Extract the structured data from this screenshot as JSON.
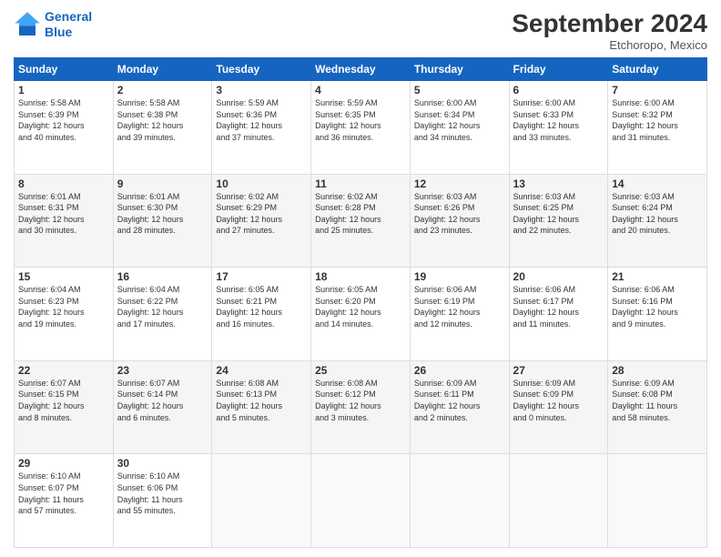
{
  "header": {
    "logo_line1": "General",
    "logo_line2": "Blue",
    "month": "September 2024",
    "location": "Etchoropo, Mexico"
  },
  "weekdays": [
    "Sunday",
    "Monday",
    "Tuesday",
    "Wednesday",
    "Thursday",
    "Friday",
    "Saturday"
  ],
  "weeks": [
    [
      {
        "day": "1",
        "info": "Sunrise: 5:58 AM\nSunset: 6:39 PM\nDaylight: 12 hours\nand 40 minutes."
      },
      {
        "day": "2",
        "info": "Sunrise: 5:58 AM\nSunset: 6:38 PM\nDaylight: 12 hours\nand 39 minutes."
      },
      {
        "day": "3",
        "info": "Sunrise: 5:59 AM\nSunset: 6:36 PM\nDaylight: 12 hours\nand 37 minutes."
      },
      {
        "day": "4",
        "info": "Sunrise: 5:59 AM\nSunset: 6:35 PM\nDaylight: 12 hours\nand 36 minutes."
      },
      {
        "day": "5",
        "info": "Sunrise: 6:00 AM\nSunset: 6:34 PM\nDaylight: 12 hours\nand 34 minutes."
      },
      {
        "day": "6",
        "info": "Sunrise: 6:00 AM\nSunset: 6:33 PM\nDaylight: 12 hours\nand 33 minutes."
      },
      {
        "day": "7",
        "info": "Sunrise: 6:00 AM\nSunset: 6:32 PM\nDaylight: 12 hours\nand 31 minutes."
      }
    ],
    [
      {
        "day": "8",
        "info": "Sunrise: 6:01 AM\nSunset: 6:31 PM\nDaylight: 12 hours\nand 30 minutes."
      },
      {
        "day": "9",
        "info": "Sunrise: 6:01 AM\nSunset: 6:30 PM\nDaylight: 12 hours\nand 28 minutes."
      },
      {
        "day": "10",
        "info": "Sunrise: 6:02 AM\nSunset: 6:29 PM\nDaylight: 12 hours\nand 27 minutes."
      },
      {
        "day": "11",
        "info": "Sunrise: 6:02 AM\nSunset: 6:28 PM\nDaylight: 12 hours\nand 25 minutes."
      },
      {
        "day": "12",
        "info": "Sunrise: 6:03 AM\nSunset: 6:26 PM\nDaylight: 12 hours\nand 23 minutes."
      },
      {
        "day": "13",
        "info": "Sunrise: 6:03 AM\nSunset: 6:25 PM\nDaylight: 12 hours\nand 22 minutes."
      },
      {
        "day": "14",
        "info": "Sunrise: 6:03 AM\nSunset: 6:24 PM\nDaylight: 12 hours\nand 20 minutes."
      }
    ],
    [
      {
        "day": "15",
        "info": "Sunrise: 6:04 AM\nSunset: 6:23 PM\nDaylight: 12 hours\nand 19 minutes."
      },
      {
        "day": "16",
        "info": "Sunrise: 6:04 AM\nSunset: 6:22 PM\nDaylight: 12 hours\nand 17 minutes."
      },
      {
        "day": "17",
        "info": "Sunrise: 6:05 AM\nSunset: 6:21 PM\nDaylight: 12 hours\nand 16 minutes."
      },
      {
        "day": "18",
        "info": "Sunrise: 6:05 AM\nSunset: 6:20 PM\nDaylight: 12 hours\nand 14 minutes."
      },
      {
        "day": "19",
        "info": "Sunrise: 6:06 AM\nSunset: 6:19 PM\nDaylight: 12 hours\nand 12 minutes."
      },
      {
        "day": "20",
        "info": "Sunrise: 6:06 AM\nSunset: 6:17 PM\nDaylight: 12 hours\nand 11 minutes."
      },
      {
        "day": "21",
        "info": "Sunrise: 6:06 AM\nSunset: 6:16 PM\nDaylight: 12 hours\nand 9 minutes."
      }
    ],
    [
      {
        "day": "22",
        "info": "Sunrise: 6:07 AM\nSunset: 6:15 PM\nDaylight: 12 hours\nand 8 minutes."
      },
      {
        "day": "23",
        "info": "Sunrise: 6:07 AM\nSunset: 6:14 PM\nDaylight: 12 hours\nand 6 minutes."
      },
      {
        "day": "24",
        "info": "Sunrise: 6:08 AM\nSunset: 6:13 PM\nDaylight: 12 hours\nand 5 minutes."
      },
      {
        "day": "25",
        "info": "Sunrise: 6:08 AM\nSunset: 6:12 PM\nDaylight: 12 hours\nand 3 minutes."
      },
      {
        "day": "26",
        "info": "Sunrise: 6:09 AM\nSunset: 6:11 PM\nDaylight: 12 hours\nand 2 minutes."
      },
      {
        "day": "27",
        "info": "Sunrise: 6:09 AM\nSunset: 6:09 PM\nDaylight: 12 hours\nand 0 minutes."
      },
      {
        "day": "28",
        "info": "Sunrise: 6:09 AM\nSunset: 6:08 PM\nDaylight: 11 hours\nand 58 minutes."
      }
    ],
    [
      {
        "day": "29",
        "info": "Sunrise: 6:10 AM\nSunset: 6:07 PM\nDaylight: 11 hours\nand 57 minutes."
      },
      {
        "day": "30",
        "info": "Sunrise: 6:10 AM\nSunset: 6:06 PM\nDaylight: 11 hours\nand 55 minutes."
      },
      {
        "day": "",
        "info": ""
      },
      {
        "day": "",
        "info": ""
      },
      {
        "day": "",
        "info": ""
      },
      {
        "day": "",
        "info": ""
      },
      {
        "day": "",
        "info": ""
      }
    ]
  ]
}
